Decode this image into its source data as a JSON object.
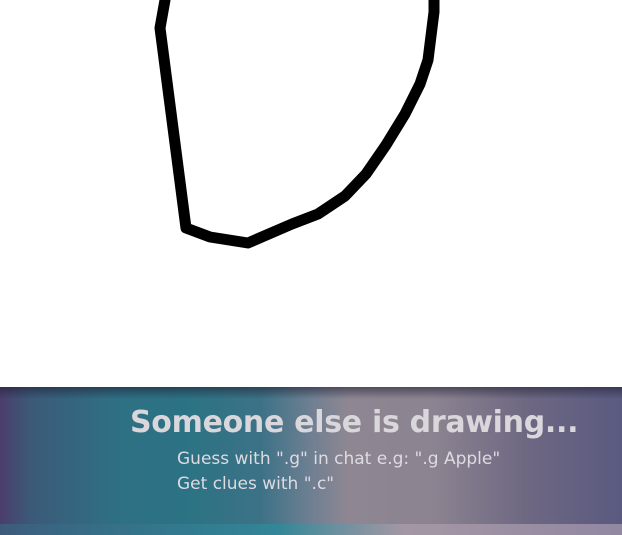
{
  "status": {
    "title": "Someone else is drawing...",
    "hints": [
      "Guess with \".g\" in chat e.g: \".g Apple\"",
      "Get clues with \".c\""
    ]
  },
  "drawing": {
    "stroke_color": "#000000",
    "background_color": "#ffffff"
  },
  "overlay": {
    "text_color": "#d9d6dc"
  }
}
